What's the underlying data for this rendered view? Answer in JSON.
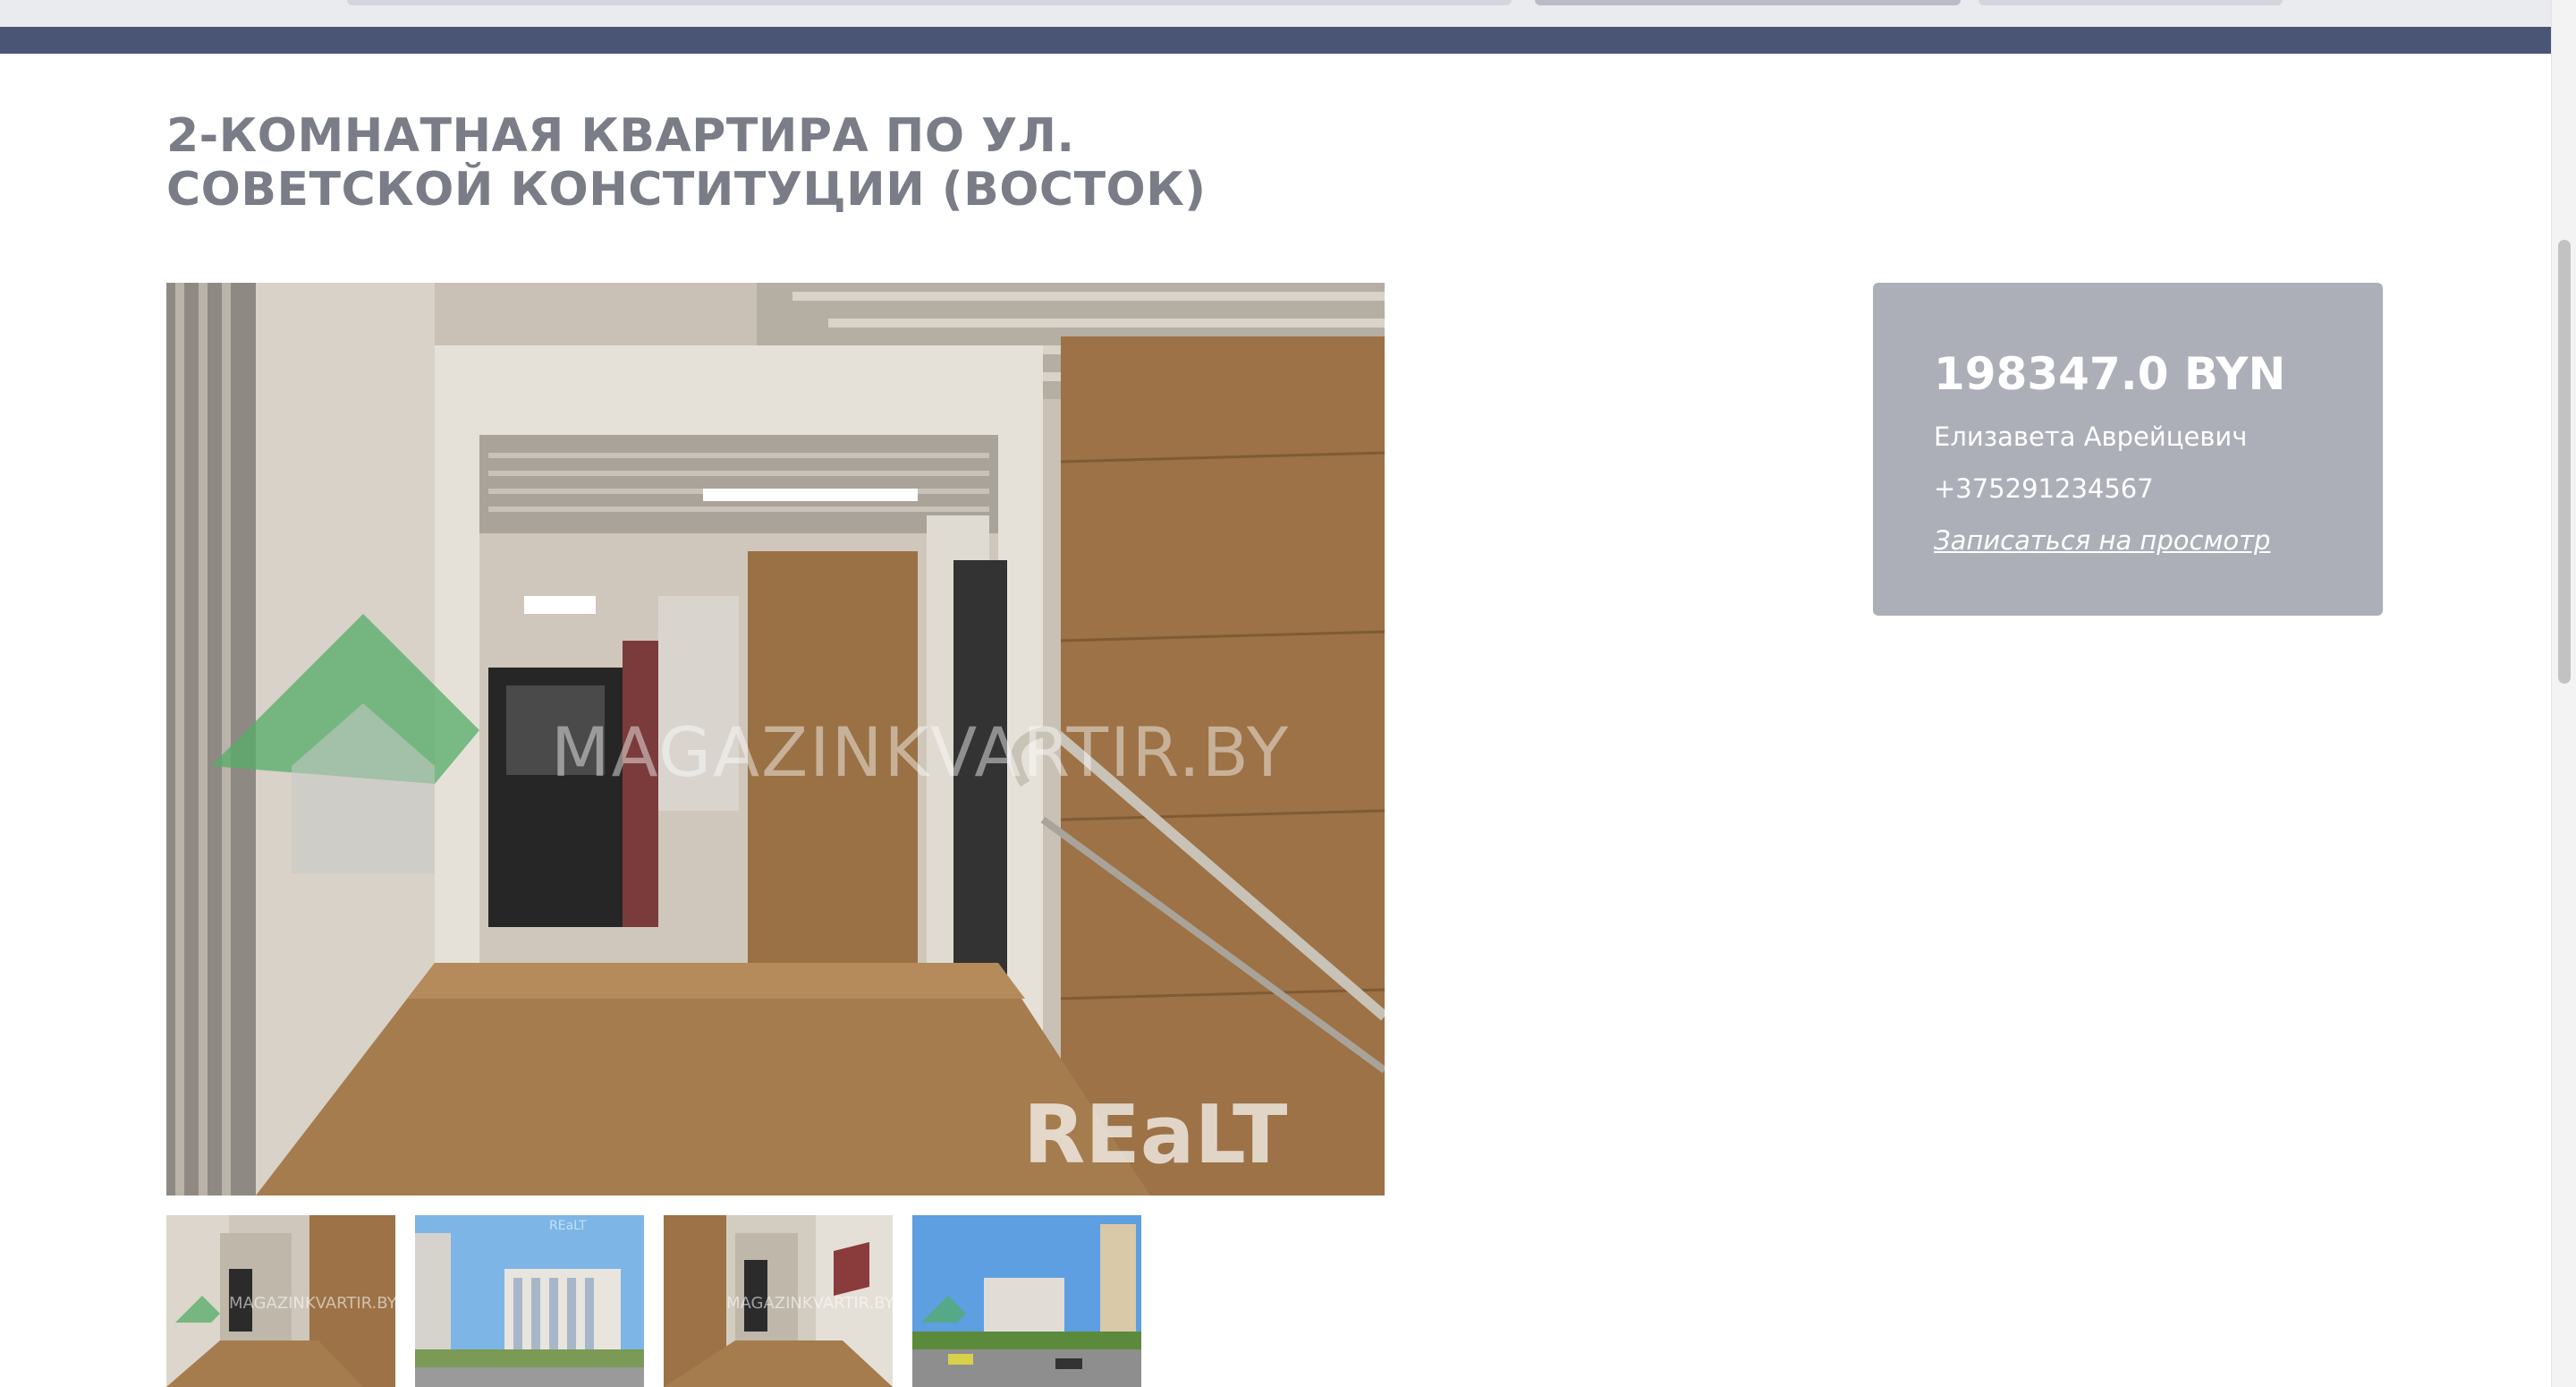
{
  "listing": {
    "title": "2-комнатная квартира по ул. Советской Конституции (Восток)"
  },
  "gallery": {
    "watermark_site": "MAGAZINKVARTIR.BY",
    "watermark_brand": "REaLT",
    "thumbnails": [
      {
        "kind": "interior-lobby",
        "watermark": "MAGAZINKVARTIR.BY"
      },
      {
        "kind": "exterior-buildings",
        "watermark": "REaLT"
      },
      {
        "kind": "interior-stairs",
        "watermark": "MAGAZINKVARTIR.BY"
      },
      {
        "kind": "exterior-street",
        "watermark": ""
      }
    ]
  },
  "card": {
    "price": "198347.0 BYN",
    "agent": "Елизавета Аврейцевич",
    "phone": "+375291234567",
    "book_link": "Записаться на просмотр"
  },
  "colors": {
    "nav": "#4a5575",
    "card": "#acafb8",
    "title": "#7a7d87"
  }
}
